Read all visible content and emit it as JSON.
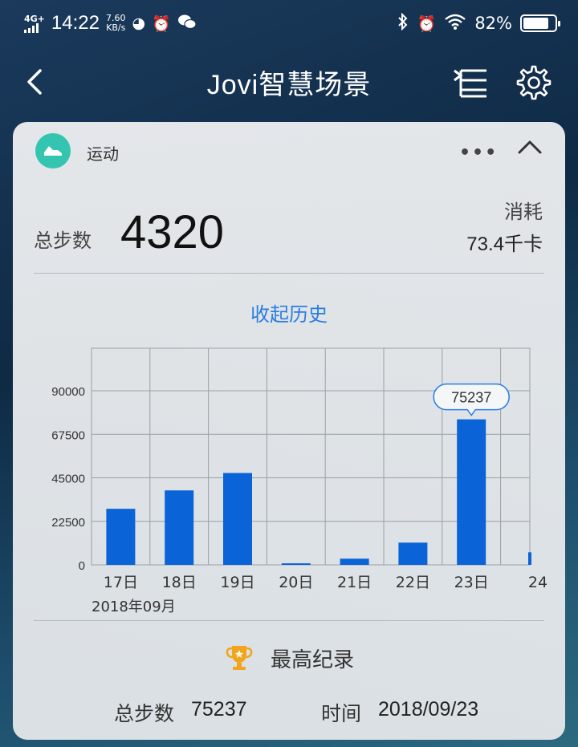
{
  "statusbar": {
    "network": "4G+",
    "time": "14:22",
    "speed_value": "7.60",
    "speed_unit": "KB/s",
    "battery": "82%",
    "battery_level": 0.82,
    "icons": [
      "signal-icon",
      "browser-icon",
      "alarm-icon",
      "wechat-icon",
      "bluetooth-icon",
      "alarm-icon",
      "wifi-icon",
      "battery-icon"
    ]
  },
  "header": {
    "title": "Jovi智慧场景"
  },
  "card": {
    "app_name": "运动",
    "more": "•••",
    "steps_label": "总步数",
    "steps_value": "4320",
    "consumption_label": "消耗",
    "consumption_value": "73.4千卡",
    "history_toggle": "收起历史"
  },
  "chart_data": {
    "type": "bar",
    "categories": [
      "17日",
      "18日",
      "19日",
      "20日",
      "21日",
      "22日",
      "23日",
      "24"
    ],
    "values": [
      29000,
      38500,
      47500,
      800,
      3200,
      11500,
      75237,
      6500
    ],
    "y_ticks": [
      "0",
      "22500",
      "45000",
      "67500",
      "90000"
    ],
    "ylim": [
      0,
      112000
    ],
    "x_sublabel": "2018年09月",
    "highlight_label": "75237",
    "highlight_index": 6,
    "bar_color": "#0a64d8",
    "grid": true
  },
  "record": {
    "title": "最高纪录",
    "steps_label": "总步数",
    "steps_value": "75237",
    "time_label": "时间",
    "time_value": "2018/09/23"
  },
  "colors": {
    "accent": "#2a7de1",
    "app_icon": "#34c5b0",
    "trophy": "#f2a41c"
  }
}
